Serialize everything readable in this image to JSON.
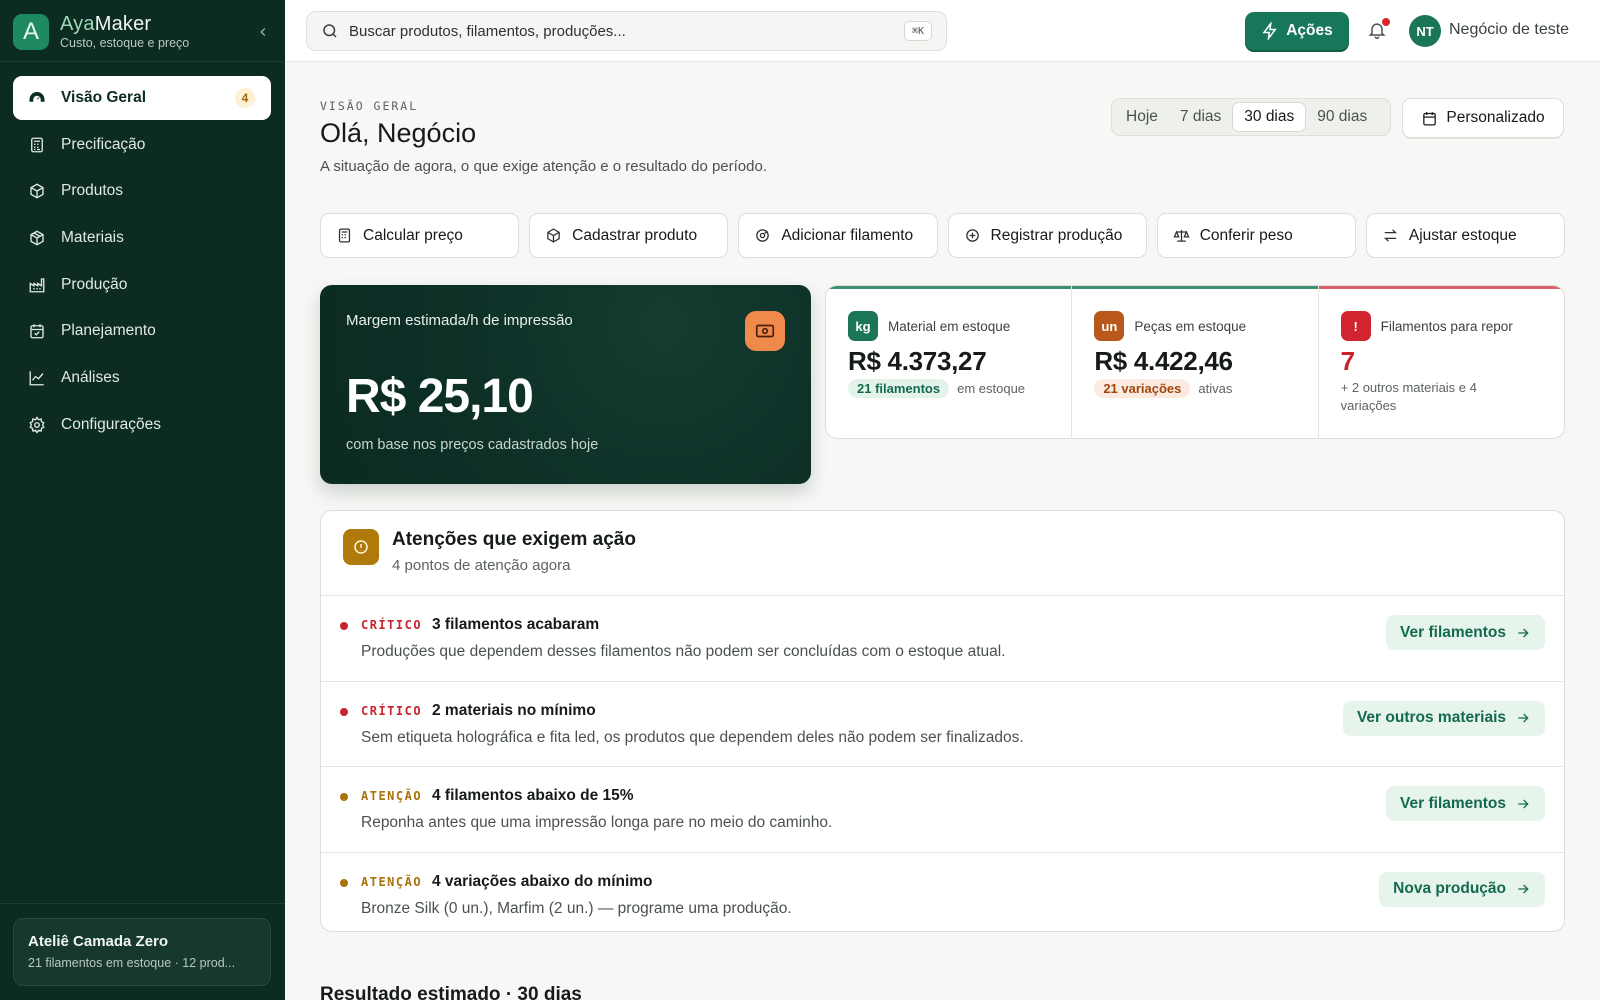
{
  "brand": {
    "logo_letter": "A",
    "name_prefix": "Aya",
    "name_suffix": "Maker",
    "tagline": "Custo, estoque e preço"
  },
  "sidebar": {
    "items": [
      {
        "label": "Visão Geral",
        "icon": "dashboard-gauge-icon",
        "active": true,
        "badge": "4"
      },
      {
        "label": "Precificação",
        "icon": "calculator-icon"
      },
      {
        "label": "Produtos",
        "icon": "box-icon"
      },
      {
        "label": "Materiais",
        "icon": "package-icon"
      },
      {
        "label": "Produção",
        "icon": "factory-icon"
      },
      {
        "label": "Planejamento",
        "icon": "calendar-check-icon"
      },
      {
        "label": "Análises",
        "icon": "line-chart-icon"
      },
      {
        "label": "Configurações",
        "icon": "gear-icon"
      }
    ],
    "workspace": {
      "name": "Ateliê Camada Zero",
      "summary": "21 filamentos em estoque · 12 prod..."
    }
  },
  "topbar": {
    "search_placeholder": "Buscar produtos, filamentos, produções...",
    "shortcut": "⌘K",
    "actions_label": "Ações",
    "account_initials": "NT",
    "account_name": "Negócio de teste"
  },
  "page": {
    "eyebrow": "VISÃO GERAL",
    "greeting": "Olá, Negócio",
    "subtitle": "A situação de agora, o que exige atenção e o resultado do período.",
    "ranges": [
      "Hoje",
      "7 dias",
      "30 dias",
      "90 dias"
    ],
    "selected_range": "30 dias",
    "custom_label": "Personalizado"
  },
  "quick_actions": [
    {
      "label": "Calcular preço",
      "icon": "calculator-icon"
    },
    {
      "label": "Cadastrar produto",
      "icon": "box-icon"
    },
    {
      "label": "Adicionar filamento",
      "icon": "spool-icon"
    },
    {
      "label": "Registrar produção",
      "icon": "plus-circle-icon"
    },
    {
      "label": "Conferir peso",
      "icon": "scale-icon"
    },
    {
      "label": "Ajustar estoque",
      "icon": "arrows-swap-icon"
    }
  ],
  "hero": {
    "label": "Margem estimada/h de impressão",
    "value": "R$ 25,10",
    "footnote": "com base nos preços cadastrados hoje",
    "icon": "banknote-icon",
    "icon_color": "#f08a4b"
  },
  "kpis": [
    {
      "badge": "kg",
      "badge_color": "#1b7657",
      "bar_color": "#3f8f72",
      "label": "Material em estoque",
      "value": "R$ 4.373,27",
      "pill": "21 filamentos",
      "pill_bg": "#e3f3ea",
      "pill_fg": "#146a4f",
      "suffix": "em estoque"
    },
    {
      "badge": "un",
      "badge_color": "#b8581a",
      "bar_color": "#3f8f72",
      "label": "Peças em estoque",
      "value": "R$ 4.422,46",
      "pill": "21 variações",
      "pill_bg": "#fbeadf",
      "pill_fg": "#a1470f",
      "suffix": "ativas"
    },
    {
      "badge": "!",
      "badge_color": "#d1242f",
      "bar_color": "#d9606a",
      "label": "Filamentos para repor",
      "value": "7",
      "note": "+ 2 outros materiais e 4 variações"
    }
  ],
  "attention": {
    "title": "Atenções que exigem ação",
    "subtitle": "4 pontos de atenção agora",
    "items": [
      {
        "severity": "CRÍTICO",
        "color": "#c9242d",
        "title": "3 filamentos acabaram",
        "description": "Produções que dependem desses filamentos não podem ser concluídas com o estoque atual.",
        "action": "Ver filamentos"
      },
      {
        "severity": "CRÍTICO",
        "color": "#c9242d",
        "title": "2 materiais no mínimo",
        "description": "Sem etiqueta holográfica e fita led, os produtos que dependem deles não podem ser finalizados.",
        "action": "Ver outros materiais"
      },
      {
        "severity": "ATENÇÃO",
        "color": "#a7730a",
        "title": "4 filamentos abaixo de 15%",
        "description": "Reponha antes que uma impressão longa pare no meio do caminho.",
        "action": "Ver filamentos"
      },
      {
        "severity": "ATENÇÃO",
        "color": "#a7730a",
        "title": "4 variações abaixo do mínimo",
        "description": "Bronze Silk (0 un.), Marfim (2 un.) — programe uma produção.",
        "action": "Nova produção"
      }
    ]
  },
  "result_section_title": "Resultado estimado · 30 dias"
}
